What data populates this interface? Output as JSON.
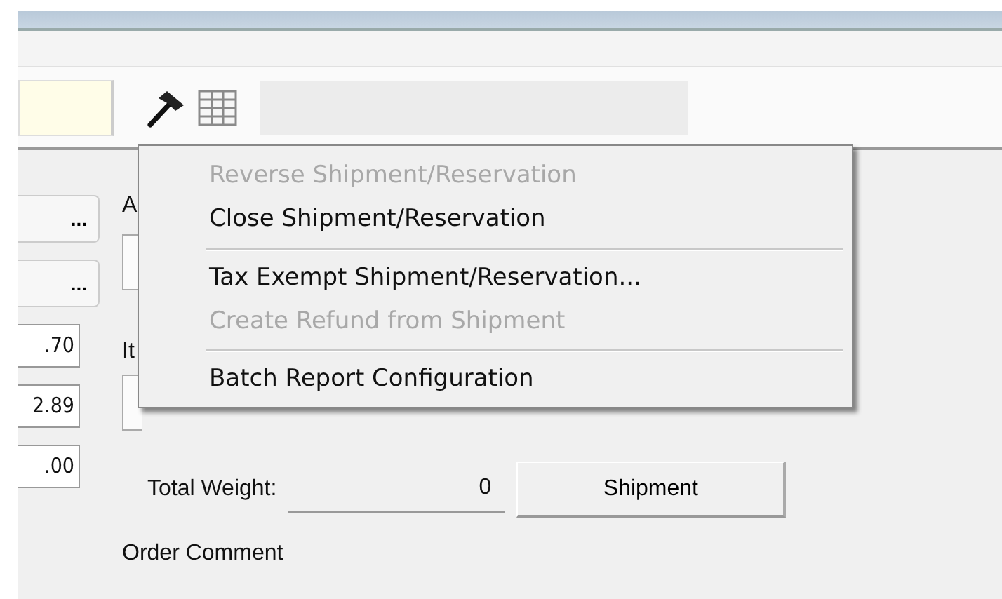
{
  "left_column": {
    "buttons": [
      "...",
      "..."
    ],
    "values": [
      ".70",
      "2.89",
      ".00"
    ]
  },
  "form": {
    "partial_labels": [
      "A",
      "It"
    ],
    "total_weight_label": "Total Weight:",
    "total_weight_value": "0",
    "shipment_button": "Shipment",
    "order_comment_label": "Order Comment"
  },
  "context_menu": {
    "items": [
      {
        "kind": "item",
        "label": "Reverse Shipment/Reservation",
        "disabled": true
      },
      {
        "kind": "item",
        "label": "Close Shipment/Reservation",
        "disabled": false
      },
      {
        "kind": "separator"
      },
      {
        "kind": "item",
        "label": "Tax Exempt Shipment/Reservation...",
        "disabled": false
      },
      {
        "kind": "item",
        "label": "Create Refund from Shipment",
        "disabled": true
      },
      {
        "kind": "separator"
      },
      {
        "kind": "item",
        "label": "Batch Report Configuration",
        "disabled": false
      }
    ]
  }
}
